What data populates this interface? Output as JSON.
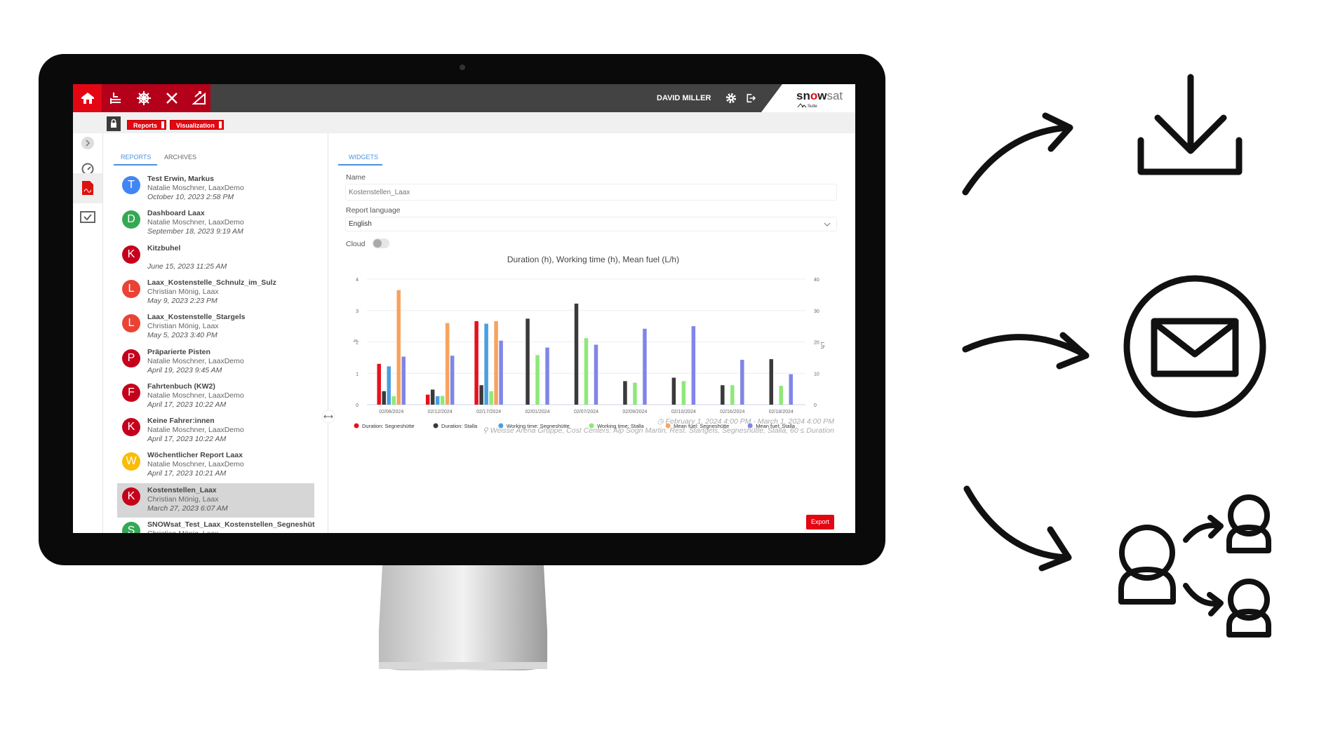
{
  "topbar": {
    "user": "DAVID MILLER",
    "logo": "snowsat Suite",
    "icons": [
      "home-icon",
      "snowplow-icon",
      "snowflake-gear-icon",
      "tools-icon",
      "slope-icon",
      "gear-icon",
      "logout-icon"
    ]
  },
  "subbar": {
    "reports": "Reports",
    "visualization": "Visualization"
  },
  "list": {
    "tabs": [
      "REPORTS",
      "ARCHIVES"
    ],
    "items": [
      {
        "letter": "T",
        "color": "#4285f4",
        "title": "Test Erwin, Markus",
        "author": "Natalie Moschner, LaaxDemo",
        "date": "October 10, 2023 2:58 PM"
      },
      {
        "letter": "D",
        "color": "#34a853",
        "title": "Dashboard Laax",
        "author": "Natalie Moschner, LaaxDemo",
        "date": "September 18, 2023 9:19 AM"
      },
      {
        "letter": "K",
        "color": "#c5001c",
        "title": "Kitzbuhel",
        "author": "",
        "date": "June 15, 2023 11:25 AM"
      },
      {
        "letter": "L",
        "color": "#ea4335",
        "title": "Laax_Kostenstelle_Schnulz_im_Sulz",
        "author": "Christian Mönig, Laax",
        "date": "May 9, 2023 2:23 PM"
      },
      {
        "letter": "L",
        "color": "#ea4335",
        "title": "Laax_Kostenstelle_Stargels",
        "author": "Christian Mönig, Laax",
        "date": "May 5, 2023 3:40 PM"
      },
      {
        "letter": "P",
        "color": "#c5001c",
        "title": "Präparierte Pisten",
        "author": "Natalie Moschner, LaaxDemo",
        "date": "April 19, 2023 9:45 AM"
      },
      {
        "letter": "F",
        "color": "#c5001c",
        "title": "Fahrtenbuch (KW2)",
        "author": "Natalie Moschner, LaaxDemo",
        "date": "April 17, 2023 10:22 AM"
      },
      {
        "letter": "K",
        "color": "#c5001c",
        "title": "Keine Fahrer:innen",
        "author": "Natalie Moschner, LaaxDemo",
        "date": "April 17, 2023 10:22 AM"
      },
      {
        "letter": "W",
        "color": "#fbbc05",
        "title": "Wöchentlicher Report Laax",
        "author": "Natalie Moschner, LaaxDemo",
        "date": "April 17, 2023 10:21 AM"
      },
      {
        "letter": "K",
        "color": "#c5001c",
        "title": "Kostenstellen_Laax",
        "author": "Christian Mönig, Laax",
        "date": "March 27, 2023 6:07 AM",
        "selected": true
      },
      {
        "letter": "S",
        "color": "#34a853",
        "title": "SNOWsat_Test_Laax_Kostenstellen_Segneshüt",
        "author": "Christian Mönig, Laax",
        "date": ""
      }
    ]
  },
  "main": {
    "tab": "WIDGETS",
    "name_label": "Name",
    "name_placeholder": "Kostenstellen_Laax",
    "lang_label": "Report language",
    "lang_value": "English",
    "cloud_label": "Cloud",
    "cloud_on": false,
    "period": "February 1, 2024 4:00 PM - March 1, 2024 4:00 PM",
    "filter": "Weisse Arena Gruppe, Cost Centers: Alp Sogn Martin, Rest. Startgels, Segneshütte, Stalla, 60 ≤ Duration",
    "export": "Export"
  },
  "chart_data": {
    "type": "bar",
    "title": "Duration (h), Working time (h), Mean fuel (L/h)",
    "ylabel": "h",
    "y2label": "L/h",
    "ylim": [
      0,
      4
    ],
    "y2lim": [
      0,
      40
    ],
    "yticks": [
      "0",
      "1",
      "2",
      "3",
      "4"
    ],
    "y2ticks": [
      "0",
      "10",
      "20",
      "30",
      "40"
    ],
    "grid": true,
    "legend": "bottom",
    "categories": [
      "02/08/2024",
      "02/12/2024",
      "02/17/2024",
      "02/01/2024",
      "02/07/2024",
      "02/09/2024",
      "02/10/2024",
      "02/16/2024",
      "02/18/2024"
    ],
    "series": [
      {
        "name": "Duration: Segneshütte",
        "color": "#e8101e",
        "axis": "left",
        "values": [
          1.3,
          0.32,
          2.66,
          null,
          null,
          null,
          null,
          null,
          null
        ]
      },
      {
        "name": "Duration: Stalla",
        "color": "#3a3a3a",
        "axis": "left",
        "values": [
          0.43,
          0.48,
          0.62,
          2.74,
          3.22,
          0.75,
          0.86,
          0.62,
          1.45
        ]
      },
      {
        "name": "Working time: Segneshütte",
        "color": "#4a9fe0",
        "axis": "left",
        "values": [
          1.22,
          0.27,
          2.58,
          null,
          null,
          null,
          null,
          null,
          null
        ]
      },
      {
        "name": "Working time: Stalla",
        "color": "#8ee878",
        "axis": "left",
        "values": [
          0.27,
          0.28,
          0.43,
          1.58,
          2.12,
          0.7,
          0.75,
          0.62,
          0.6
        ]
      },
      {
        "name": "Mean fuel: Segneshütte",
        "color": "#f7a35c",
        "axis": "right",
        "values": [
          36.5,
          26,
          26.6,
          null,
          null,
          null,
          null,
          null,
          null
        ]
      },
      {
        "name": "Mean fuel: Stalla",
        "color": "#8085e9",
        "axis": "right",
        "values": [
          15.3,
          15.6,
          20.4,
          18.2,
          19.1,
          24.2,
          25,
          14.3,
          9.7
        ]
      }
    ]
  },
  "actions": [
    "download-icon",
    "mail-icon",
    "share-users-icon"
  ]
}
